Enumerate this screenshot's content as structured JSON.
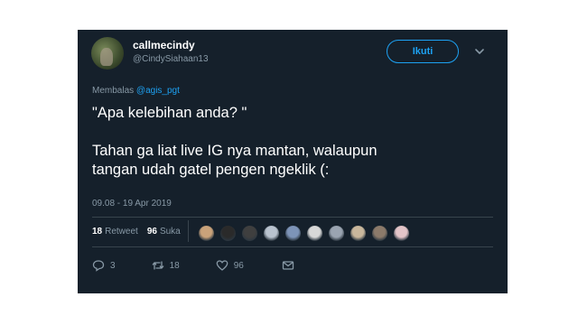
{
  "author": {
    "name": "callmecindy",
    "handle": "@CindySiahaan13"
  },
  "follow_label": "Ikuti",
  "reply_prefix": "Membalas",
  "reply_to": "@agis_pgt",
  "tweet": {
    "line1": "\"Apa kelebihan anda? \"",
    "line2": "Tahan ga liat live IG nya mantan, walaupun",
    "line3": "tangan udah gatel pengen ngeklik (:"
  },
  "timestamp": "09.08 - 19 Apr 2019",
  "stats": {
    "retweets_count": "18",
    "retweets_label": "Retweet",
    "likes_count": "96",
    "likes_label": "Suka"
  },
  "liker_avatar_colors": [
    "#c9a27a",
    "#2a2a2a",
    "#3f3f3f",
    "#b9c3cf",
    "#7d94b8",
    "#d8d8d8",
    "#9aa4b1",
    "#c9b79c",
    "#8c7a6a",
    "#e3c4c8"
  ],
  "actions": {
    "reply_count": "3",
    "retweet_count": "18",
    "like_count": "96"
  },
  "colors": {
    "background": "#15202b",
    "accent": "#1da1f2",
    "muted": "#8899a6"
  },
  "icons": [
    "chevron-down-icon",
    "reply-icon",
    "retweet-icon",
    "like-icon",
    "message-icon"
  ]
}
